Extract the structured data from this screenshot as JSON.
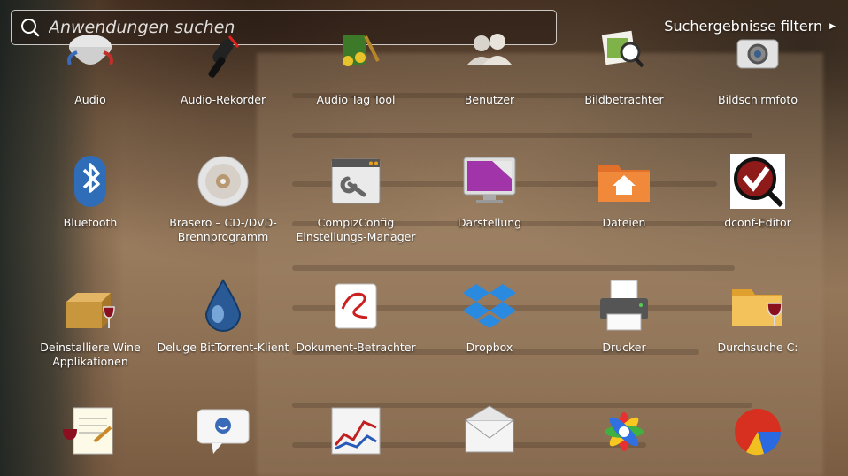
{
  "search": {
    "placeholder": "Anwendungen suchen",
    "value": ""
  },
  "filter": {
    "label": "Suchergebnisse filtern"
  },
  "apps": [
    {
      "label": "Audio",
      "icon": "audio-icon"
    },
    {
      "label": "Audio-Rekorder",
      "icon": "microphone-icon"
    },
    {
      "label": "Audio Tag Tool",
      "icon": "music-notes-icon"
    },
    {
      "label": "Benutzer",
      "icon": "users-icon"
    },
    {
      "label": "Bildbetrachter",
      "icon": "image-viewer-icon"
    },
    {
      "label": "Bildschirmfoto",
      "icon": "camera-icon"
    },
    {
      "label": "Bluetooth",
      "icon": "bluetooth-icon"
    },
    {
      "label": "Brasero – CD-/DVD-Brennprogramm",
      "icon": "disc-icon"
    },
    {
      "label": "CompizConfig Einstellungs-Manager",
      "icon": "settings-window-icon"
    },
    {
      "label": "Darstellung",
      "icon": "display-icon"
    },
    {
      "label": "Dateien",
      "icon": "home-folder-icon"
    },
    {
      "label": "dconf-Editor",
      "icon": "dconf-magnifier-icon"
    },
    {
      "label": "Deinstalliere Wine Applikationen",
      "icon": "wine-box-icon"
    },
    {
      "label": "Deluge BitTorrent-Klient",
      "icon": "water-drop-icon"
    },
    {
      "label": "Dokument-Betrachter",
      "icon": "document-viewer-icon"
    },
    {
      "label": "Dropbox",
      "icon": "dropbox-icon"
    },
    {
      "label": "Drucker",
      "icon": "printer-icon"
    },
    {
      "label": "Durchsuche C:",
      "icon": "wine-folder-icon"
    },
    {
      "label": "",
      "icon": "wine-notepad-icon"
    },
    {
      "label": "",
      "icon": "chat-bubble-icon"
    },
    {
      "label": "",
      "icon": "line-graph-icon"
    },
    {
      "label": "",
      "icon": "envelope-icon"
    },
    {
      "label": "",
      "icon": "flower-icon"
    },
    {
      "label": "",
      "icon": "pie-chart-icon"
    }
  ]
}
